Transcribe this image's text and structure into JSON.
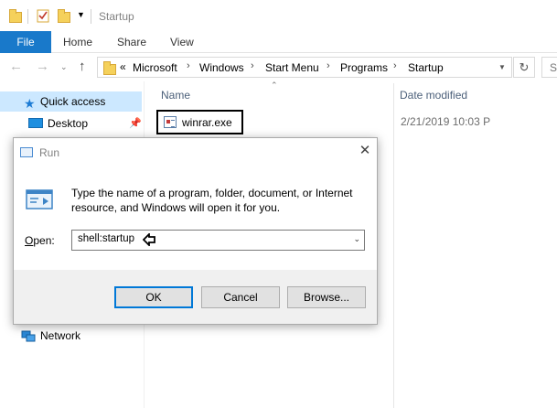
{
  "window": {
    "title": "Startup"
  },
  "ribbon": {
    "tabs": [
      "File",
      "Home",
      "Share",
      "View"
    ]
  },
  "address": {
    "overflow": "«",
    "crumbs": [
      "Microsoft",
      "Windows",
      "Start Menu",
      "Programs",
      "Startup"
    ],
    "search_placeholder": "S"
  },
  "nav": {
    "items": [
      {
        "label": "Quick access",
        "icon": "star-icon"
      },
      {
        "label": "Desktop",
        "icon": "desktop-icon"
      },
      {
        "label": "Network",
        "icon": "network-icon"
      }
    ]
  },
  "content": {
    "columns": [
      "Name",
      "Date modified"
    ],
    "files": [
      {
        "name": "winrar.exe",
        "date": "2/21/2019 10:03 P"
      }
    ]
  },
  "run_dialog": {
    "title": "Run",
    "message": "Type the name of a program, folder, document, or Internet resource, and Windows will open it for you.",
    "open_label": "Open:",
    "input_value": "shell:startup",
    "ok_label": "OK",
    "cancel_label": "Cancel",
    "browse_label": "Browse..."
  },
  "colors": {
    "file_tab": "#1979ca",
    "selection": "#cce8ff",
    "default_button_border": "#0078d7"
  }
}
